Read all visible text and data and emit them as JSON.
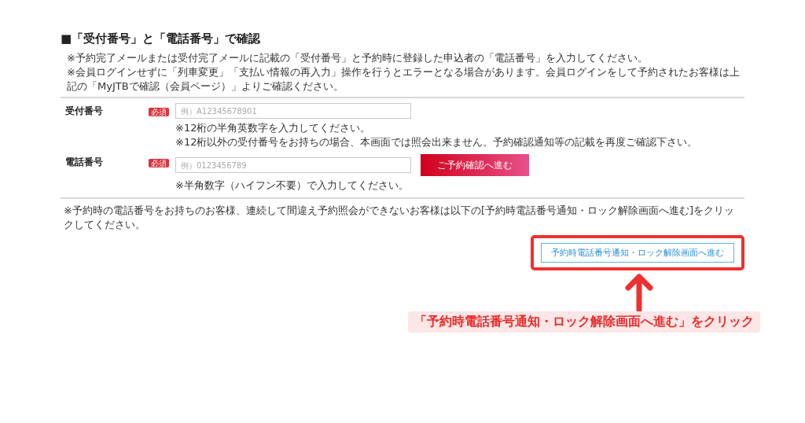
{
  "heading": "■「受付番号」と「電話番号」で確認",
  "notes": [
    "※予約完了メールまたは受付完了メールに記載の「受付番号」と予約時に登録した申込者の「電話番号」を入力してください。",
    "※会員ログインせずに「列車変更」「支払い情報の再入力」操作を行うとエラーとなる場合があります。会員ログインをして予約されたお客様は上記の「MyJTBで確認（会員ページ）」よりご確認ください。"
  ],
  "fields": [
    {
      "label": "受付番号",
      "badge": "必須",
      "placeholder": "例）A12345678901",
      "hints": [
        "※12桁の半角英数字を入力してください。",
        "※12桁以外の受付番号をお持ちの場合、本画面では照会出来ません。予約確認通知等の記載を再度ご確認下さい。"
      ]
    },
    {
      "label": "電話番号",
      "badge": "必須",
      "placeholder": "例）0123456789",
      "hints": [
        "※半角数字（ハイフン不要）で入力してください。"
      ],
      "button": "ご予約確認へ進む"
    }
  ],
  "footer_note": "※予約時の電話番号をお持ちのお客様、連続して間違え予約照会ができないお客様は以下の[予約時電話番号通知・ロック解除画面へ進む]をクリックしてください。",
  "unlock_button": "予約時電話番号通知・ロック解除画面へ進む",
  "callout": "「予約時電話番号通知・ロック解除画面へ進む」をクリック"
}
